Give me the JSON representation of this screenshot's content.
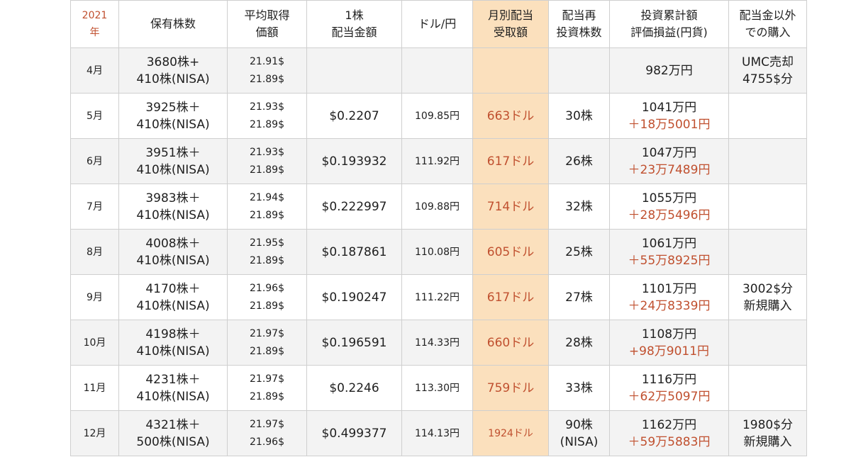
{
  "headers": {
    "year": [
      "2021",
      "年"
    ],
    "shares": [
      "保有株数"
    ],
    "avg_price": [
      "平均取得",
      "価額"
    ],
    "dividend_per_share": [
      "1株",
      "配当金額"
    ],
    "fx": [
      "ドル/円"
    ],
    "monthly_dividend": [
      "月別配当",
      "受取額"
    ],
    "reinvest": [
      "配当再",
      "投資株数"
    ],
    "valuation": [
      "投資累計額",
      "評価損益(円貨)"
    ],
    "other_purchase": [
      "配当金以外",
      "での購入"
    ]
  },
  "rows": [
    {
      "month": "4月",
      "shares": [
        "3680株+",
        "410株(NISA)"
      ],
      "avg_price": [
        "21.91$",
        "21.89$"
      ],
      "dividend_per_share": "",
      "fx": "",
      "monthly_dividend": "",
      "reinvest": [
        ""
      ],
      "valuation": [
        "982万円",
        ""
      ],
      "other_purchase": [
        "UMC売却",
        "4755$分"
      ]
    },
    {
      "month": "5月",
      "shares": [
        "3925株＋",
        "410株(NISA)"
      ],
      "avg_price": [
        "21.93$",
        "21.89$"
      ],
      "dividend_per_share": "$0.2207",
      "fx": "109.85円",
      "monthly_dividend": "663ドル",
      "reinvest": [
        "30株"
      ],
      "valuation": [
        "1041万円",
        "＋18万5001円"
      ],
      "other_purchase": [
        "",
        ""
      ]
    },
    {
      "month": "6月",
      "shares": [
        "3951株＋",
        "410株(NISA)"
      ],
      "avg_price": [
        "21.93$",
        "21.89$"
      ],
      "dividend_per_share": "$0.193932",
      "fx": "111.92円",
      "monthly_dividend": "617ドル",
      "reinvest": [
        "26株"
      ],
      "valuation": [
        "1047万円",
        "＋23万7489円"
      ],
      "other_purchase": [
        "",
        ""
      ]
    },
    {
      "month": "7月",
      "shares": [
        "3983株＋",
        "410株(NISA)"
      ],
      "avg_price": [
        "21.94$",
        "21.89$"
      ],
      "dividend_per_share": "$0.222997",
      "fx": "109.88円",
      "monthly_dividend": "714ドル",
      "reinvest": [
        "32株"
      ],
      "valuation": [
        "1055万円",
        "＋28万5496円"
      ],
      "other_purchase": [
        "",
        ""
      ]
    },
    {
      "month": "8月",
      "shares": [
        "4008株＋",
        "410株(NISA)"
      ],
      "avg_price": [
        "21.95$",
        "21.89$"
      ],
      "dividend_per_share": "$0.187861",
      "fx": "110.08円",
      "monthly_dividend": "605ドル",
      "reinvest": [
        "25株"
      ],
      "valuation": [
        "1061万円",
        "＋55万8925円"
      ],
      "other_purchase": [
        "",
        ""
      ]
    },
    {
      "month": "9月",
      "shares": [
        "4170株＋",
        "410株(NISA)"
      ],
      "avg_price": [
        "21.96$",
        "21.89$"
      ],
      "dividend_per_share": "$0.190247",
      "fx": "111.22円",
      "monthly_dividend": "617ドル",
      "reinvest": [
        "27株"
      ],
      "valuation": [
        "1101万円",
        "＋24万8339円"
      ],
      "other_purchase": [
        "3002$分",
        "新規購入"
      ]
    },
    {
      "month": "10月",
      "shares": [
        "4198株＋",
        "410株(NISA)"
      ],
      "avg_price": [
        "21.97$",
        "21.89$"
      ],
      "dividend_per_share": "$0.196591",
      "fx": "114.33円",
      "monthly_dividend": "660ドル",
      "reinvest": [
        "28株"
      ],
      "valuation": [
        "1108万円",
        "+98万9011円"
      ],
      "other_purchase": [
        "",
        ""
      ]
    },
    {
      "month": "11月",
      "shares": [
        "4231株＋",
        "410株(NISA)"
      ],
      "avg_price": [
        "21.97$",
        "21.89$"
      ],
      "dividend_per_share": "$0.2246",
      "fx": "113.30円",
      "monthly_dividend": "759ドル",
      "reinvest": [
        "33株"
      ],
      "valuation": [
        "1116万円",
        "＋62万5097円"
      ],
      "other_purchase": [
        "",
        ""
      ]
    },
    {
      "month": "12月",
      "shares": [
        "4321株＋",
        "500株(NISA)"
      ],
      "avg_price": [
        "21.97$",
        "21.96$"
      ],
      "dividend_per_share": "$0.499377",
      "fx": "114.13円",
      "monthly_dividend": "1924ドル",
      "reinvest": [
        "90株",
        "(NISA)"
      ],
      "valuation": [
        "1162万円",
        "＋59万5883円"
      ],
      "other_purchase": [
        "1980$分",
        "新規購入"
      ]
    }
  ],
  "colors": {
    "accent": "#c0502f",
    "highlight": "#fbe0bd",
    "stripe": "#f3f3f3",
    "border": "#cfcfcf"
  }
}
